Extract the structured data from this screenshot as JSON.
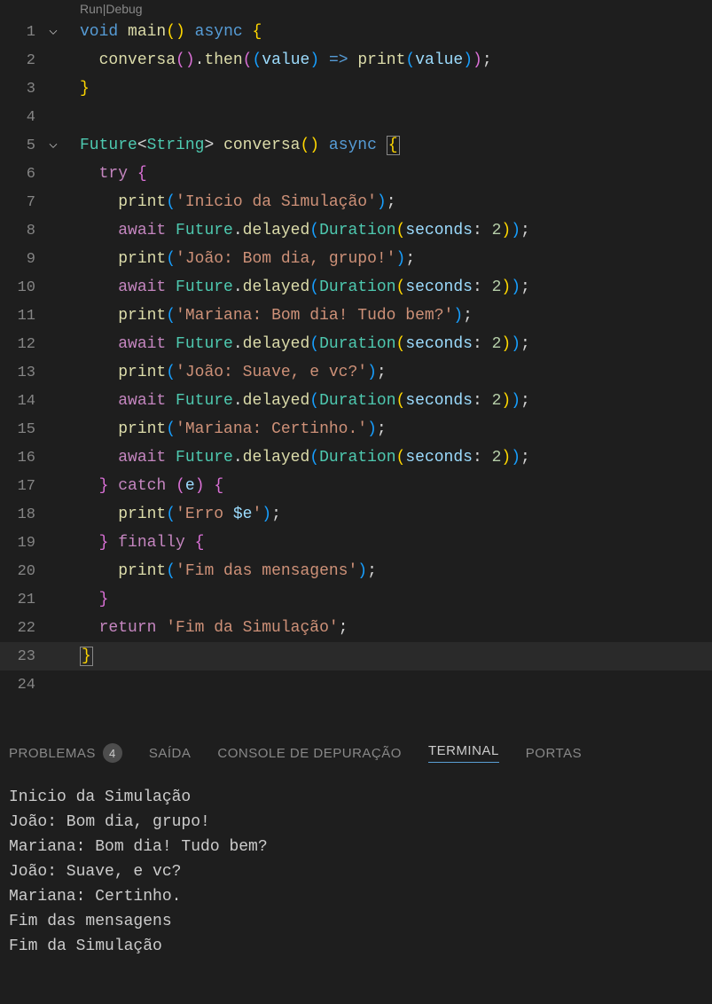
{
  "codelens": {
    "run": "Run",
    "debug": "Debug",
    "separator": " | "
  },
  "lines": {
    "l1_void": "void",
    "l1_main": "main",
    "l1_async": "async",
    "l2_conversa": "conversa",
    "l2_then": "then",
    "l2_value": "value",
    "l2_print": "print",
    "l2_value2": "value",
    "l5_future": "Future",
    "l5_string": "String",
    "l5_conversa": "conversa",
    "l5_async": "async",
    "l6_try": "try",
    "l7_print": "print",
    "l7_str": "'Inicio da Simulação'",
    "l8_await": "await",
    "l8_future": "Future",
    "l8_delayed": "delayed",
    "l8_duration": "Duration",
    "l8_seconds": "seconds",
    "l8_num": "2",
    "l9_print": "print",
    "l9_str": "'João: Bom dia, grupo!'",
    "l10_await": "await",
    "l10_future": "Future",
    "l10_delayed": "delayed",
    "l10_duration": "Duration",
    "l10_seconds": "seconds",
    "l10_num": "2",
    "l11_print": "print",
    "l11_str": "'Mariana: Bom dia! Tudo bem?'",
    "l12_await": "await",
    "l12_future": "Future",
    "l12_delayed": "delayed",
    "l12_duration": "Duration",
    "l12_seconds": "seconds",
    "l12_num": "2",
    "l13_print": "print",
    "l13_str": "'João: Suave, e vc?'",
    "l14_await": "await",
    "l14_future": "Future",
    "l14_delayed": "delayed",
    "l14_duration": "Duration",
    "l14_seconds": "seconds",
    "l14_num": "2",
    "l15_print": "print",
    "l15_str": "'Mariana: Certinho.'",
    "l16_await": "await",
    "l16_future": "Future",
    "l16_delayed": "delayed",
    "l16_duration": "Duration",
    "l16_seconds": "seconds",
    "l16_num": "2",
    "l17_catch": "catch",
    "l17_e": "e",
    "l18_print": "print",
    "l18_erro": "'Erro ",
    "l18_dollar": "$e",
    "l18_quote": "'",
    "l19_finally": "finally",
    "l20_print": "print",
    "l20_str": "'Fim das mensagens'",
    "l22_return": "return",
    "l22_str": "'Fim da Simulação'"
  },
  "lineNumbers": [
    "1",
    "2",
    "3",
    "4",
    "5",
    "6",
    "7",
    "8",
    "9",
    "10",
    "11",
    "12",
    "13",
    "14",
    "15",
    "16",
    "17",
    "18",
    "19",
    "20",
    "21",
    "22",
    "23",
    "24"
  ],
  "tabs": {
    "problemas": "PROBLEMAS",
    "problemas_count": "4",
    "saida": "SAÍDA",
    "console": "CONSOLE DE DEPURAÇÃO",
    "terminal": "TERMINAL",
    "portas": "PORTAS"
  },
  "terminal": {
    "lines": [
      "Inicio da Simulação",
      "João: Bom dia, grupo!",
      "Mariana: Bom dia! Tudo bem?",
      "João: Suave, e vc?",
      "Mariana: Certinho.",
      "Fim das mensagens",
      "Fim da Simulação"
    ]
  }
}
